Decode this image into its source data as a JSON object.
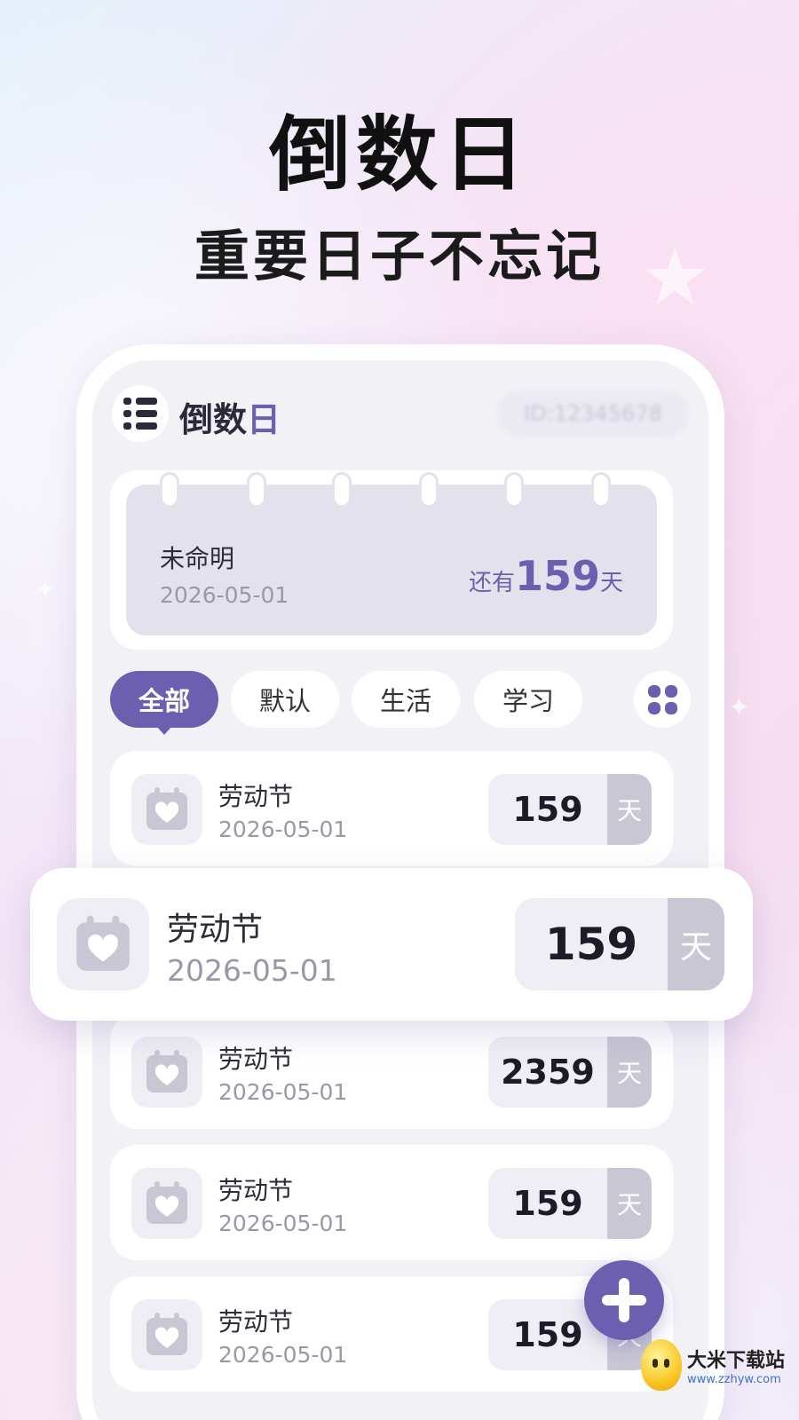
{
  "hero": {
    "title": "倒数日",
    "subtitle": "重要日子不忘记"
  },
  "app": {
    "title_main": "倒数",
    "title_accent": "日",
    "user_id": "ID:12345678"
  },
  "featured": {
    "name": "未命明",
    "date": "2026-05-01",
    "prefix": "还有",
    "days": "159",
    "suffix": "天"
  },
  "tabs": [
    {
      "label": "全部",
      "active": true
    },
    {
      "label": "默认",
      "active": false
    },
    {
      "label": "生活",
      "active": false
    },
    {
      "label": "学习",
      "active": false
    }
  ],
  "list": [
    {
      "name": "劳动节",
      "date": "2026-05-01",
      "days": "159",
      "unit": "天"
    },
    {
      "name": "劳动节",
      "date": "2026-05-01",
      "days": "2359",
      "unit": "天"
    },
    {
      "name": "劳动节",
      "date": "2026-05-01",
      "days": "159",
      "unit": "天"
    },
    {
      "name": "劳动节",
      "date": "2026-05-01",
      "days": "159",
      "unit": "天"
    }
  ],
  "highlight": {
    "name": "劳动节",
    "date": "2026-05-01",
    "days": "159",
    "unit": "天"
  },
  "icons": {
    "menu": "list-menu-icon",
    "grid": "grid-icon",
    "calendar": "calendar-heart-icon",
    "add": "plus-icon"
  },
  "colors": {
    "accent": "#6c5fb0",
    "card_bg": "#e3e1ec",
    "unit_bg": "#c9c7d3"
  },
  "watermark": {
    "title": "大米下载站",
    "url": "www.zzhyw.com"
  }
}
